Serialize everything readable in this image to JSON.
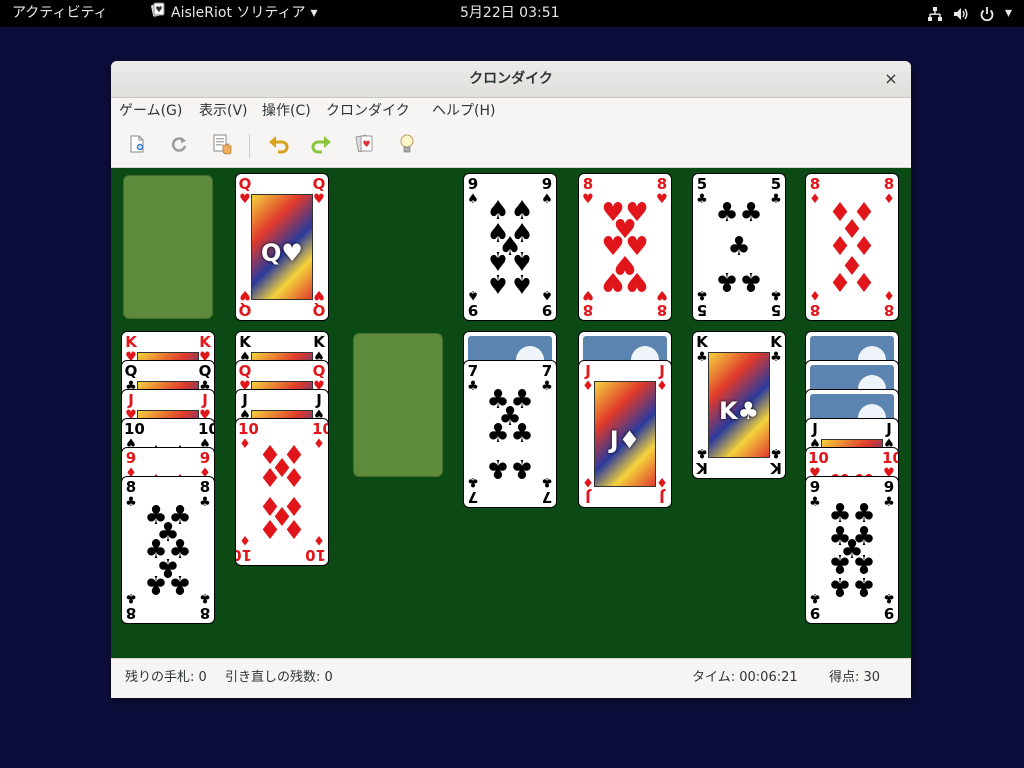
{
  "topbar": {
    "activities": "アクティビティ",
    "app_name": "AisleRiot ソリティア",
    "clock": "5月22日  03:51",
    "icons": [
      "network-icon",
      "volume-icon",
      "power-icon"
    ]
  },
  "window": {
    "title": "クロンダイク",
    "close_glyph": "×"
  },
  "menu": [
    "ゲーム(G)",
    "表示(V)",
    "操作(C)",
    "クロンダイク",
    "ヘルプ(H)"
  ],
  "toolbar": [
    "new-game-icon",
    "restart-icon",
    "select-game-icon",
    "undo-icon",
    "redo-icon",
    "deal-icon",
    "hint-icon"
  ],
  "status": {
    "stock_left": "残りの手札: 0",
    "redeals_left": "引き直しの残数: 0",
    "time": "タイム: 00:06:21",
    "score": "得点: 30"
  },
  "colors": {
    "board": "#0b4a14",
    "slot": "#5e8a3c",
    "red_suit": "#e0161b",
    "card_back": "#5b84b1"
  },
  "game": {
    "stock": [],
    "waste": [
      {
        "rank": "Q",
        "suit": "♥"
      }
    ],
    "foundations": [
      [
        {
          "rank": "9",
          "suit": "♠"
        }
      ],
      [
        {
          "rank": "8",
          "suit": "♥"
        }
      ],
      [
        {
          "rank": "5",
          "suit": "♣"
        }
      ],
      [
        {
          "rank": "8",
          "suit": "♦"
        }
      ]
    ],
    "tableau": [
      {
        "face_down": 0,
        "cards": [
          {
            "rank": "K",
            "suit": "♥"
          },
          {
            "rank": "Q",
            "suit": "♣"
          },
          {
            "rank": "J",
            "suit": "♥"
          },
          {
            "rank": "10",
            "suit": "♠"
          },
          {
            "rank": "9",
            "suit": "♦"
          },
          {
            "rank": "8",
            "suit": "♣"
          }
        ]
      },
      {
        "face_down": 0,
        "cards": [
          {
            "rank": "K",
            "suit": "♠"
          },
          {
            "rank": "Q",
            "suit": "♥"
          },
          {
            "rank": "J",
            "suit": "♠"
          },
          {
            "rank": "10",
            "suit": "♦"
          }
        ]
      },
      {
        "face_down": 0,
        "cards": []
      },
      {
        "face_down": 1,
        "cards": [
          {
            "rank": "7",
            "suit": "♣"
          }
        ]
      },
      {
        "face_down": 1,
        "cards": [
          {
            "rank": "J",
            "suit": "♦"
          }
        ]
      },
      {
        "face_down": 0,
        "cards": [
          {
            "rank": "K",
            "suit": "♣"
          }
        ]
      },
      {
        "face_down": 3,
        "cards": [
          {
            "rank": "J",
            "suit": "♠"
          },
          {
            "rank": "10",
            "suit": "♥"
          },
          {
            "rank": "9",
            "suit": "♣"
          }
        ]
      }
    ]
  }
}
